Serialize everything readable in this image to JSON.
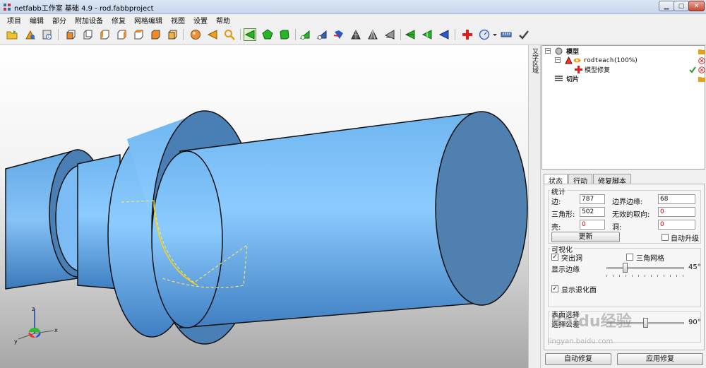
{
  "window": {
    "title": "netfabb工作室 基础 4.9 - rod.fabbproject",
    "colors": {
      "close": "#c44a33"
    }
  },
  "menu": [
    "项目",
    "编辑",
    "部分",
    "附加设备",
    "修复",
    "网格编辑",
    "视图",
    "设置",
    "帮助"
  ],
  "toolbar_icons": [
    "open-file-icon",
    "add-part-icon",
    "settings-icon",
    "view-front-icon",
    "view-back-icon",
    "view-left-icon",
    "view-right-icon",
    "view-top-icon",
    "view-bottom-icon",
    "view-iso-icon",
    "sphere-icon",
    "triangle-icon",
    "zoom-icon",
    "select-triangle-icon",
    "select-surface-icon",
    "select-shell-icon",
    "add-triangle-icon",
    "remove-triangle-icon",
    "cut-icon",
    "mesh-icon",
    "mesh-alt-icon",
    "flip-icon",
    "select-all-icon",
    "select-border-icon",
    "select-invert-icon",
    "repair-icon",
    "gauge-icon",
    "measure-icon",
    "check-icon"
  ],
  "side_tab": "又字区域",
  "tree": {
    "root_label": "模型",
    "part_label": "rodteach",
    "part_percent": "(100%)",
    "repair_label": "模型修复",
    "slice_label": "切片"
  },
  "tabs": [
    "状态",
    "行动",
    "修复脚本"
  ],
  "stats": {
    "title": "统计",
    "edges_label": "边:",
    "edges_value": "787",
    "border_edges_label": "边界边缘:",
    "border_edges_value": "68",
    "triangles_label": "三角形:",
    "triangles_value": "502",
    "invalid_orient_label": "无效的取向:",
    "invalid_orient_value": "0",
    "shells_label": "壳:",
    "shells_value": "0",
    "holes_label": "洞:",
    "holes_value": "0",
    "update_button": "更新",
    "auto_upgrade_label": "自动升级"
  },
  "visual": {
    "title": "可视化",
    "highlight_holes_label": "突出洞",
    "triangle_mesh_label": "三角网格",
    "show_edges_label": "显示边缘",
    "edge_angle": "45°",
    "edge_angle_value": 45,
    "show_degenerate_label": "显示退化面"
  },
  "selection": {
    "title": "表面选择",
    "tolerance_label": "选择公差",
    "angle": "90°"
  },
  "bottom": {
    "auto_repair": "自动修复",
    "apply_repair": "应用修复"
  },
  "watermark": {
    "text": "Baidu经验",
    "url": "jingyan.baidu.com"
  },
  "axis": {
    "x": "x",
    "y": "y",
    "z": "z"
  }
}
